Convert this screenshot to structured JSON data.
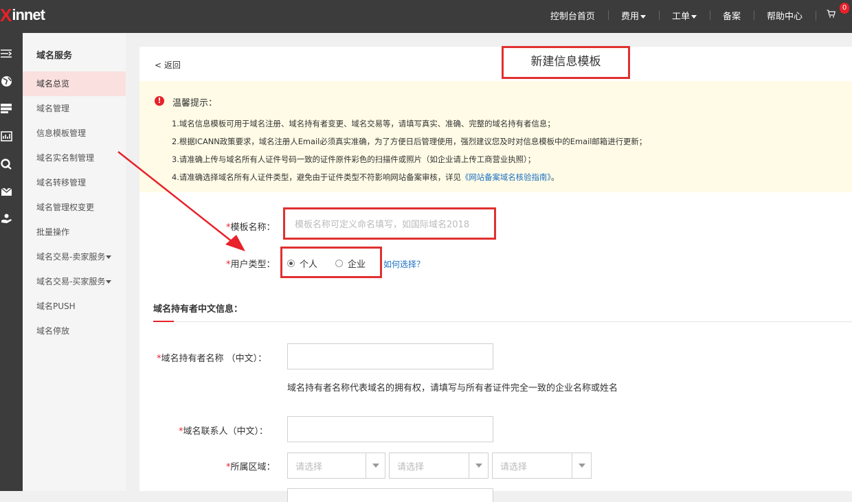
{
  "brand": {
    "logo_x": "X",
    "logo_rest": "innet"
  },
  "topnav": {
    "console": "控制台首页",
    "fees": "费用",
    "tickets": "工单",
    "filing": "备案",
    "help": "帮助中心",
    "cart_count": "0"
  },
  "iconbar": [
    "menu-toggle-icon",
    "globe-icon",
    "server-icon",
    "chart-icon",
    "link-icon",
    "mail-icon",
    "hand-icon"
  ],
  "sidebar": {
    "title": "域名服务",
    "items": [
      {
        "label": "域名总览"
      },
      {
        "label": "域名管理"
      },
      {
        "label": "信息模板管理"
      },
      {
        "label": "域名实名制管理"
      },
      {
        "label": "域名转移管理"
      },
      {
        "label": "域名管理权变更"
      },
      {
        "label": "批量操作"
      },
      {
        "label": "域名交易-卖家服务"
      },
      {
        "label": "域名交易-买家服务"
      },
      {
        "label": "域名PUSH"
      },
      {
        "label": "域名停放"
      }
    ]
  },
  "page": {
    "back": "< 返回",
    "title": "新建信息模板"
  },
  "notice": {
    "title": "温馨提示：",
    "lines": [
      "1.域名信息模板可用于域名注册、域名持有者变更、域名交易等，请填写真实、准确、完整的域名持有者信息；",
      "2.根据ICANN政策要求，域名注册人Email必须真实准确，为了方便日后管理使用，强烈建议您及时对信息模板中的Email邮箱进行更新；",
      "3.请准确上传与域名所有人证件号码一致的证件原件彩色的扫描件或照片（如企业请上传工商营业执照）；",
      "4.请准确选择域名所有人证件类型，避免由于证件类型不符影响网站备案审核，详见"
    ],
    "link": "《网站备案域名核验指南》",
    "line4_end": "。"
  },
  "form": {
    "template_name_label": "模板名称：",
    "template_name_placeholder": "模板名称可定义命名填写，如国际域名2018",
    "user_type_label": "用户类型：",
    "user_type_options": [
      "个人",
      "企业"
    ],
    "user_type_selected": "个人",
    "how_to_choose": "如何选择？",
    "section_title": "域名持有者中文信息：",
    "holder_name_label": "域名持有者名称 （中文）：",
    "holder_name_value": "",
    "holder_name_hint": "域名持有者名称代表域名的拥有权，请填写与所有者证件完全一致的企业名称或姓名",
    "contact_label": "域名联系人（中文）：",
    "contact_value": "",
    "region_label": "所属区域：",
    "region_selects": [
      "请选择",
      "请选择",
      "请选择"
    ],
    "required_mark": "*"
  }
}
